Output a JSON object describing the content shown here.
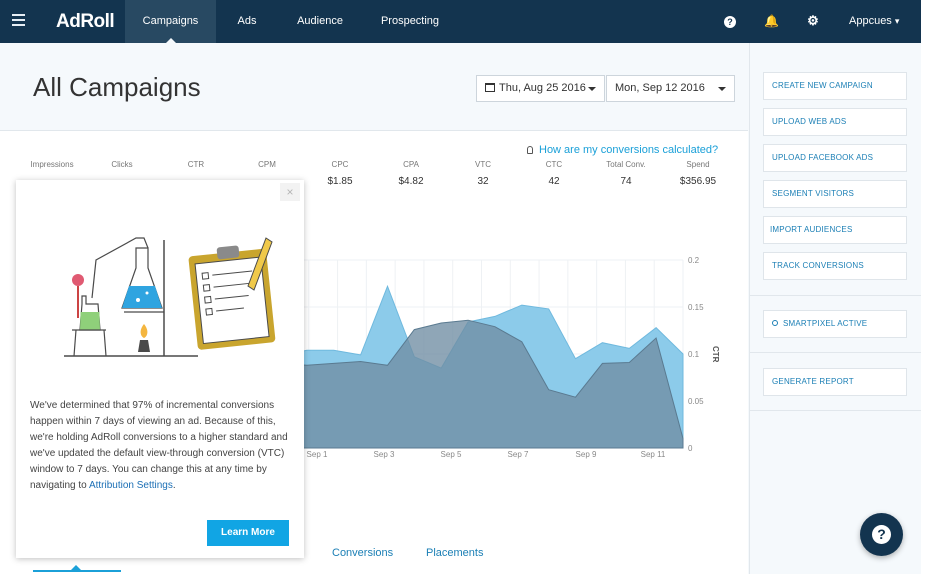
{
  "nav": {
    "logo": "AdRoll",
    "items": [
      {
        "label": "Campaigns",
        "active": true
      },
      {
        "label": "Ads"
      },
      {
        "label": "Audience"
      },
      {
        "label": "Prospecting"
      }
    ],
    "help_glyph": "?",
    "bell_glyph": "🔔",
    "gear_glyph": "⚙",
    "user": "Appcues",
    "user_caret": "▾"
  },
  "header": {
    "title": "All Campaigns",
    "date_from": "Thu, Aug 25 2016",
    "date_to": "Mon, Sep 12 2016"
  },
  "conversions_link": "How are my conversions calculated?",
  "metrics": [
    {
      "label": "Impressions",
      "value": ""
    },
    {
      "label": "Clicks",
      "value": ""
    },
    {
      "label": "CTR",
      "value": ""
    },
    {
      "label": "CPM",
      "value": ""
    },
    {
      "label": "CPC",
      "value": "$1.85"
    },
    {
      "label": "CPA",
      "value": "$4.82"
    },
    {
      "label": "VTC",
      "value": "32"
    },
    {
      "label": "CTC",
      "value": "42"
    },
    {
      "label": "Total Conv.",
      "value": "74"
    },
    {
      "label": "Spend",
      "value": "$356.95"
    }
  ],
  "sidebar": {
    "buttons": [
      "CREATE NEW CAMPAIGN",
      "UPLOAD WEB ADS",
      "UPLOAD FACEBOOK ADS",
      "SEGMENT VISITORS",
      "IMPORT AUDIENCES",
      "TRACK CONVERSIONS"
    ],
    "smartpixel": "SMARTPIXEL ACTIVE",
    "report": "GENERATE REPORT"
  },
  "popup": {
    "close_glyph": "×",
    "text_before": "We've determined that 97% of incremental conversions happen within 7 days of viewing an ad. Because of this, we're holding AdRoll conversions to a higher standard and we've updated the default view-through conversion (VTC) window to 7 days. You can change this at any time by navigating to ",
    "link_text": "Attribution Settings",
    "text_after": ".",
    "button": "Learn More"
  },
  "bottom_tabs": [
    "Conversions",
    "Placements"
  ],
  "help_fab_glyph": "?",
  "colors": {
    "nav_bg": "#13344f",
    "accent": "#1ba0d8",
    "area_light": "#8ccbea",
    "area_dark": "#6f8da3"
  },
  "chart_data": {
    "type": "area",
    "x_ticks": [
      "Sep 1",
      "Sep 3",
      "Sep 5",
      "Sep 7",
      "Sep 9",
      "Sep 11"
    ],
    "right_axis_label": "CTR",
    "right_ticks": [
      "0.2",
      "0.15",
      "0.1",
      "0.05",
      "0"
    ],
    "ylim": [
      0,
      0.2
    ],
    "series": [
      {
        "values": [
          0.098,
          0.104,
          0.104,
          0.099,
          0.172,
          0.097,
          0.085,
          0.134,
          0.14,
          0.152,
          0.148,
          0.095,
          0.112,
          0.106,
          0.128,
          0.1
        ]
      },
      {
        "values": [
          0.09,
          0.088,
          0.09,
          0.092,
          0.088,
          0.126,
          0.133,
          0.136,
          0.129,
          0.113,
          0.062,
          0.054,
          0.09,
          0.091,
          0.117,
          0.01
        ]
      }
    ]
  }
}
